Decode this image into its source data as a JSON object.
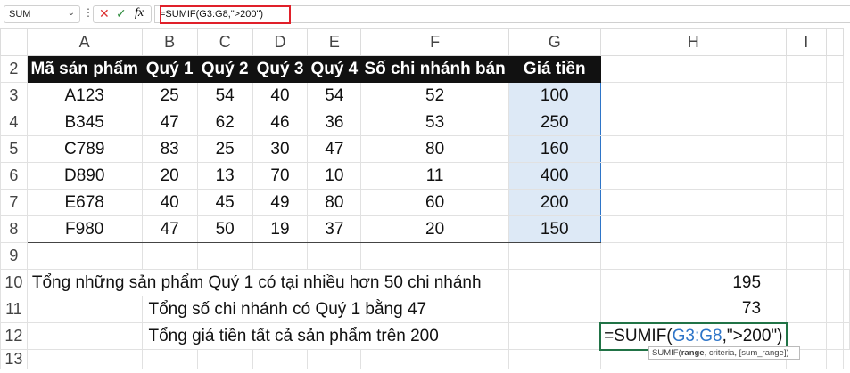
{
  "formula_bar": {
    "name_box": "SUM",
    "cancel_icon": "✕",
    "enter_icon": "✓",
    "fx_label": "fx",
    "formula": "=SUMIF(G3:G8,\">200\")"
  },
  "columns": [
    "A",
    "B",
    "C",
    "D",
    "E",
    "F",
    "G",
    "H",
    "I"
  ],
  "header_row": {
    "row": "2",
    "cells": [
      "Mã sản phẩm",
      "Quý 1",
      "Quý 2",
      "Quý 3",
      "Quý 4",
      "Số chi nhánh bán",
      "Giá tiền"
    ]
  },
  "data_rows": [
    {
      "row": "3",
      "cells": [
        "A123",
        "25",
        "54",
        "40",
        "54",
        "52",
        "100"
      ]
    },
    {
      "row": "4",
      "cells": [
        "B345",
        "47",
        "62",
        "46",
        "36",
        "53",
        "250"
      ]
    },
    {
      "row": "5",
      "cells": [
        "C789",
        "83",
        "25",
        "30",
        "47",
        "80",
        "160"
      ]
    },
    {
      "row": "6",
      "cells": [
        "D890",
        "20",
        "13",
        "70",
        "10",
        "11",
        "400"
      ]
    },
    {
      "row": "7",
      "cells": [
        "E678",
        "40",
        "45",
        "49",
        "80",
        "60",
        "200"
      ]
    },
    {
      "row": "8",
      "cells": [
        "F980",
        "47",
        "50",
        "19",
        "37",
        "20",
        "150"
      ]
    }
  ],
  "summary": [
    {
      "row": "10",
      "label": "Tổng những sản phẩm Quý 1 có tại nhiều hơn 50 chi nhánh",
      "value": "195"
    },
    {
      "row": "11",
      "label": "Tổng số chi nhánh có Quý 1 bằng 47",
      "value": "73"
    },
    {
      "row": "12",
      "label": "Tổng giá tiền tất cả sản phẩm trên 200",
      "edit": {
        "prefix": "=SUMIF(",
        "ref": "G3:G8",
        "suffix": ",\">200\")"
      }
    }
  ],
  "empty_rows": [
    "9",
    "13"
  ],
  "tooltip": {
    "prefix": "SUMIF(",
    "bold": "range",
    "rest": ", criteria, [sum_range])"
  }
}
